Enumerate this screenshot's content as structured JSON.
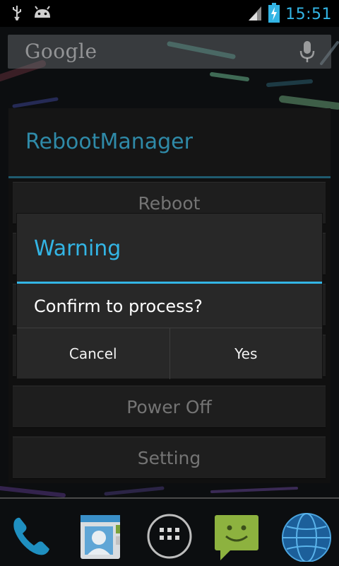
{
  "status_bar": {
    "time": "15:51",
    "icons": [
      "usb-icon",
      "android-debug-icon",
      "signal-icon",
      "battery-charging-icon"
    ],
    "accent_color": "#33b5e5"
  },
  "search_bar": {
    "logo_text": "Google",
    "icon": "mic-icon"
  },
  "app": {
    "title": "RebootManager",
    "buttons": [
      {
        "label": "Reboot"
      },
      {
        "label": ""
      },
      {
        "label": ""
      },
      {
        "label": ""
      },
      {
        "label": "Power Off"
      },
      {
        "label": "Setting"
      }
    ]
  },
  "dialog": {
    "title": "Warning",
    "message": "Confirm to process?",
    "cancel_label": "Cancel",
    "confirm_label": "Yes",
    "accent_color": "#33b5e5"
  },
  "dock": {
    "items": [
      "phone-icon",
      "contacts-icon",
      "all-apps-icon",
      "messaging-icon",
      "browser-icon"
    ]
  }
}
